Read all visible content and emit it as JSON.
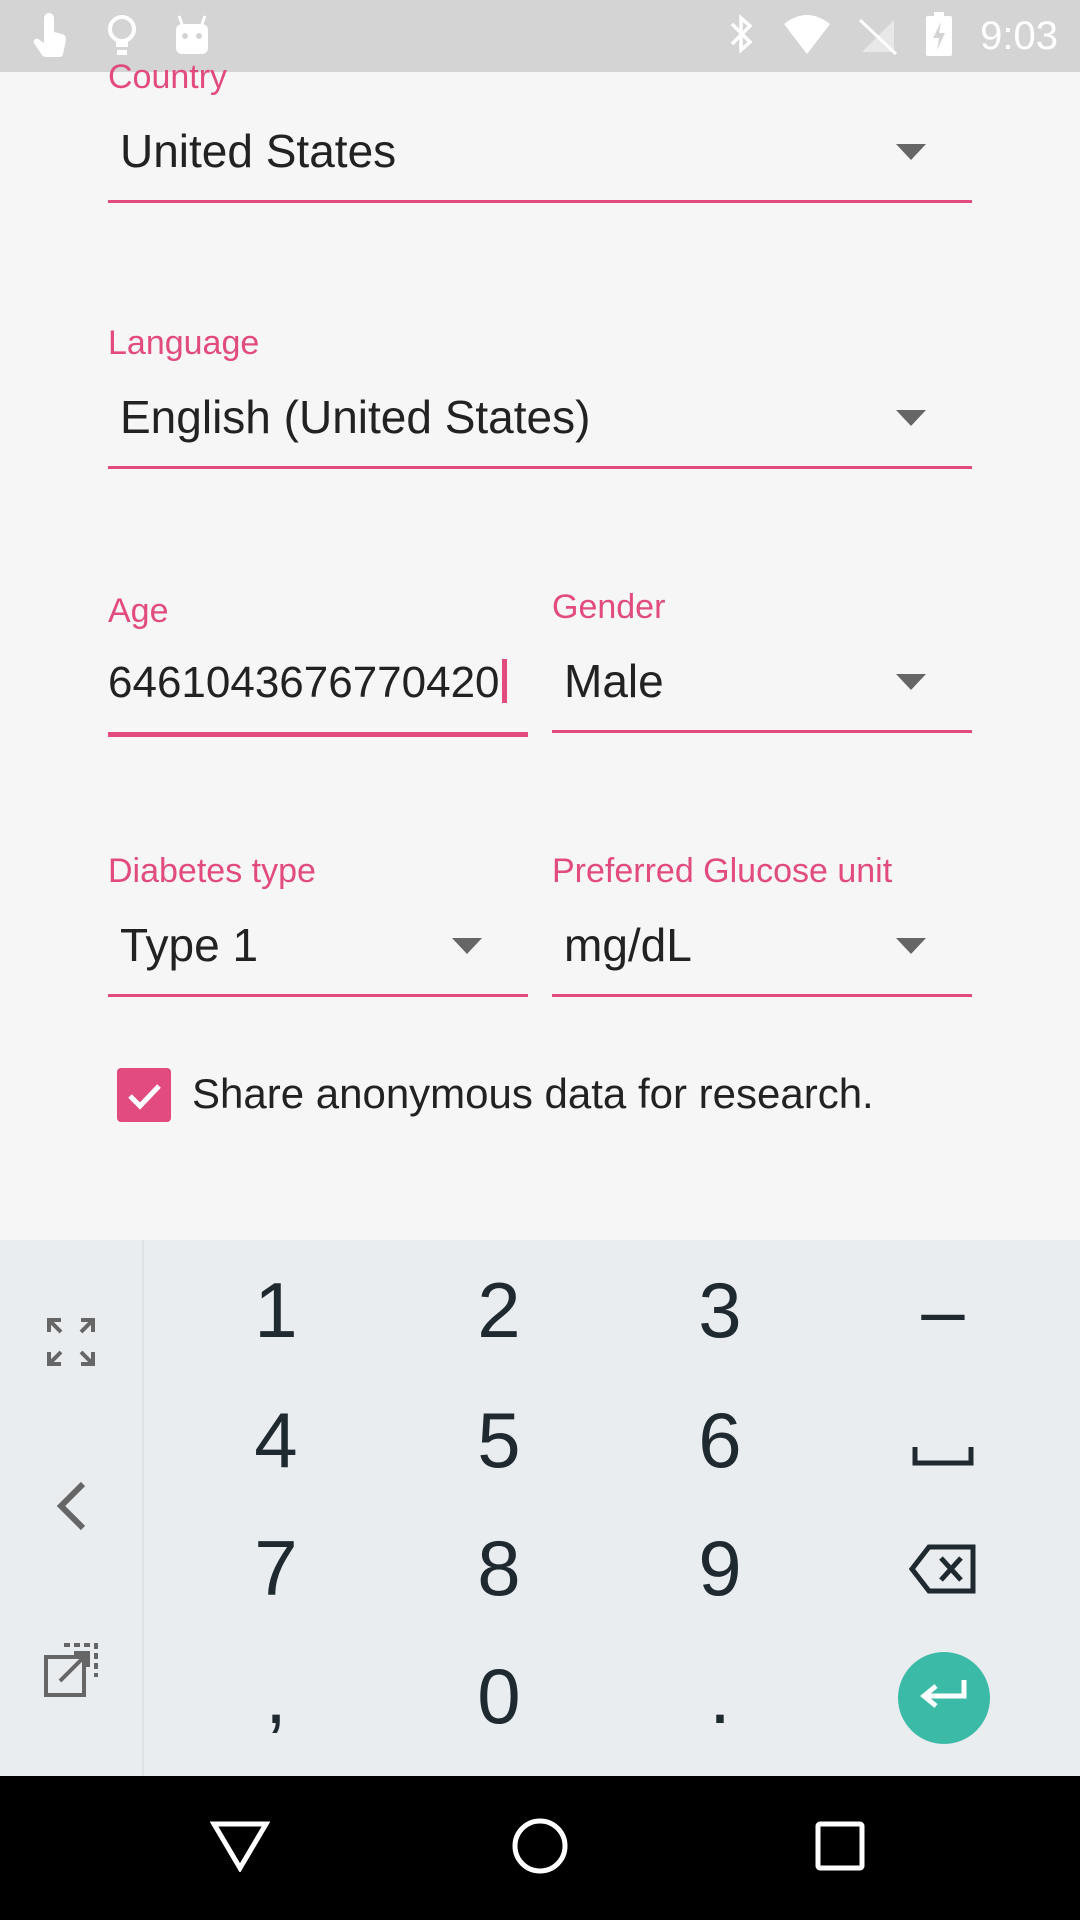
{
  "status_bar": {
    "time": "9:03",
    "left_icons": [
      "touch-icon",
      "lightbulb-icon",
      "android-icon"
    ],
    "right_icons": [
      "bluetooth-icon",
      "wifi-icon",
      "no-signal-icon",
      "battery-charging-icon"
    ]
  },
  "form": {
    "country": {
      "label": "Country",
      "value": "United States"
    },
    "language": {
      "label": "Language",
      "value": "English (United States)"
    },
    "age": {
      "label": "Age",
      "value": "6461043676770420"
    },
    "gender": {
      "label": "Gender",
      "value": "Male"
    },
    "diabetes_type": {
      "label": "Diabetes type",
      "value": "Type 1"
    },
    "glucose_unit": {
      "label": "Preferred Glucose unit",
      "value": "mg/dL"
    },
    "share_data": {
      "label": "Share anonymous data for research.",
      "checked": true
    }
  },
  "keyboard": {
    "keys": [
      "1",
      "2",
      "3",
      "–",
      "4",
      "5",
      "6",
      "7",
      "8",
      "9",
      ",",
      "0",
      "."
    ],
    "side_icons": [
      "expand-icon",
      "back-arrow-icon",
      "popout-icon"
    ],
    "special": [
      "space-icon",
      "backspace-icon",
      "enter-icon"
    ]
  },
  "nav_bar": {
    "buttons": [
      "back-nav-icon",
      "home-nav-icon",
      "recents-nav-icon"
    ]
  },
  "colors": {
    "accent": "#e24b7f",
    "enter": "#3cbaa8",
    "status_bar": "#d4d4d4"
  }
}
